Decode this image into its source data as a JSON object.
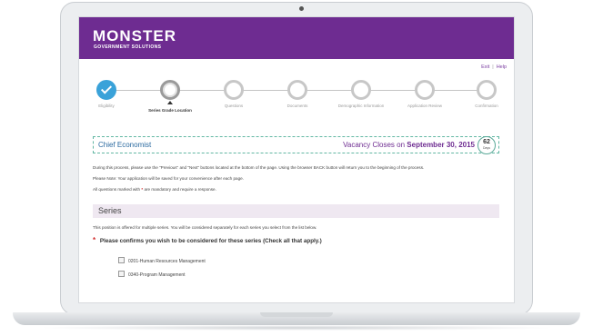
{
  "brand": {
    "name": "MONSTER",
    "subtitle": "GOVERNMENT SOLUTIONS",
    "color": "#6e2c91"
  },
  "toplinks": {
    "exit": "Exit",
    "separator": "|",
    "help": "Help"
  },
  "steps": [
    {
      "label": "Eligibility",
      "state": "done"
    },
    {
      "label": "Series Grade Location",
      "state": "current"
    },
    {
      "label": "Questions",
      "state": "pending"
    },
    {
      "label": "Documents",
      "state": "pending"
    },
    {
      "label": "Demographic Information",
      "state": "pending"
    },
    {
      "label": "Application Review",
      "state": "pending"
    },
    {
      "label": "Confirmation",
      "state": "pending"
    }
  ],
  "job": {
    "title": "Chief Economist",
    "vacancy_prefix": "Vacancy Closes on",
    "vacancy_date": "September 30, 2015",
    "days_count": "62",
    "days_label": "Days"
  },
  "instructions": {
    "line1": "During this process, please use the \"Previous\" and \"Next\" buttons located at the bottom of the page. Using the browser BACK button will return you to the beginning of the process.",
    "line2": "Please Note: Your application will be saved for your convenience after each page.",
    "line3_prefix": "All questions marked with",
    "line3_marker": "*",
    "line3_suffix": "are mandatory and require a response."
  },
  "series": {
    "heading": "Series",
    "note": "This position is offered for multiple series. You will be considered separately for each series you select from the list below.",
    "question_marker": "*",
    "question": "Please confirms you wish to be considered for these series",
    "question_hint": "(Check all that apply.)",
    "options": [
      "0201-Human Resources Management",
      "0340-Program Management"
    ]
  },
  "colors": {
    "accent": "#6e2c91",
    "done_step": "#3aa2d9",
    "required": "#d12d2d",
    "title_blue": "#2b6aa0"
  }
}
